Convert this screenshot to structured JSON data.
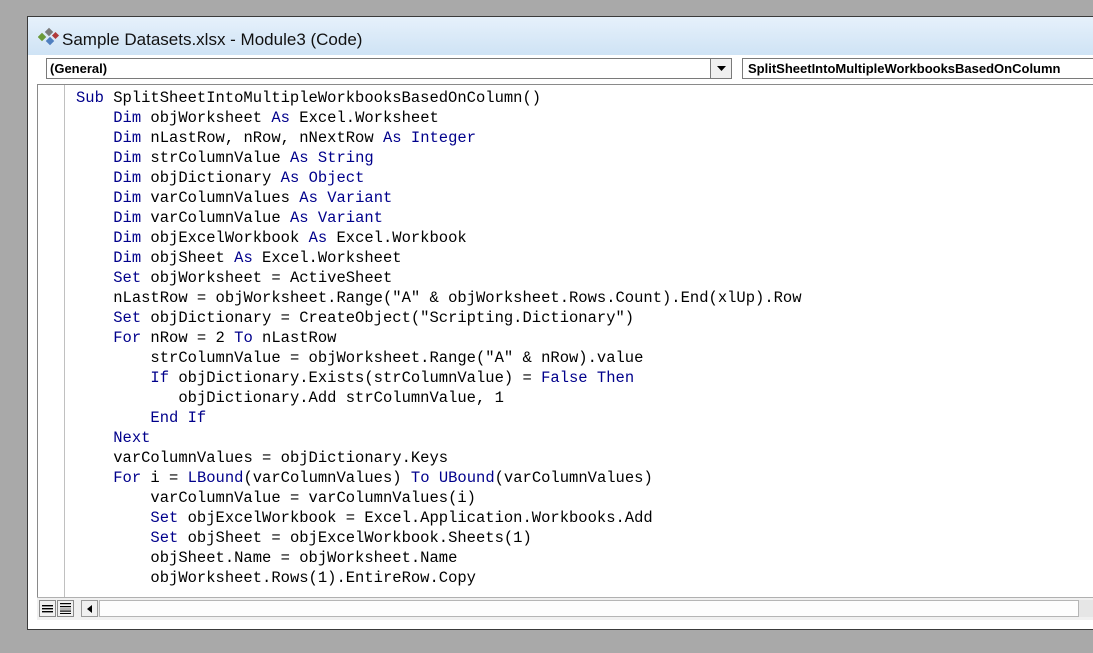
{
  "window": {
    "title": "Sample Datasets.xlsx - Module3 (Code)",
    "title_icon": "vba-code-module-icon"
  },
  "object_combo": {
    "value": "(General)",
    "dropdown_icon": "chevron-down-icon"
  },
  "procedure_combo": {
    "value": "SplitSheetIntoMultipleWorkbooksBasedOnColumn"
  },
  "colors": {
    "keyword": "#00008b",
    "text": "#000000",
    "background": "#a9a9a9"
  },
  "code_lines": [
    {
      "indent": 0,
      "segments": [
        {
          "text": "Sub",
          "kw": true
        },
        {
          "text": " SplitSheetIntoMultipleWorkbooksBasedOnColumn()"
        }
      ]
    },
    {
      "indent": 4,
      "segments": [
        {
          "text": "Dim",
          "kw": true
        },
        {
          "text": " objWorksheet "
        },
        {
          "text": "As",
          "kw": true
        },
        {
          "text": " Excel.Worksheet"
        }
      ]
    },
    {
      "indent": 4,
      "segments": [
        {
          "text": "Dim",
          "kw": true
        },
        {
          "text": " nLastRow, nRow, nNextRow "
        },
        {
          "text": "As",
          "kw": true
        },
        {
          "text": " "
        },
        {
          "text": "Integer",
          "kw": true
        }
      ]
    },
    {
      "indent": 4,
      "segments": [
        {
          "text": "Dim",
          "kw": true
        },
        {
          "text": " strColumnValue "
        },
        {
          "text": "As",
          "kw": true
        },
        {
          "text": " "
        },
        {
          "text": "String",
          "kw": true
        }
      ]
    },
    {
      "indent": 4,
      "segments": [
        {
          "text": "Dim",
          "kw": true
        },
        {
          "text": " objDictionary "
        },
        {
          "text": "As",
          "kw": true
        },
        {
          "text": " "
        },
        {
          "text": "Object",
          "kw": true
        }
      ]
    },
    {
      "indent": 4,
      "segments": [
        {
          "text": "Dim",
          "kw": true
        },
        {
          "text": " varColumnValues "
        },
        {
          "text": "As",
          "kw": true
        },
        {
          "text": " "
        },
        {
          "text": "Variant",
          "kw": true
        }
      ]
    },
    {
      "indent": 4,
      "segments": [
        {
          "text": "Dim",
          "kw": true
        },
        {
          "text": " varColumnValue "
        },
        {
          "text": "As",
          "kw": true
        },
        {
          "text": " "
        },
        {
          "text": "Variant",
          "kw": true
        }
      ]
    },
    {
      "indent": 4,
      "segments": [
        {
          "text": "Dim",
          "kw": true
        },
        {
          "text": " objExcelWorkbook "
        },
        {
          "text": "As",
          "kw": true
        },
        {
          "text": " Excel.Workbook"
        }
      ]
    },
    {
      "indent": 4,
      "segments": [
        {
          "text": "Dim",
          "kw": true
        },
        {
          "text": " objSheet "
        },
        {
          "text": "As",
          "kw": true
        },
        {
          "text": " Excel.Worksheet"
        }
      ]
    },
    {
      "indent": 4,
      "segments": [
        {
          "text": "Set",
          "kw": true
        },
        {
          "text": " objWorksheet = ActiveSheet"
        }
      ]
    },
    {
      "indent": 4,
      "segments": [
        {
          "text": "nLastRow = objWorksheet.Range(\"A\" & objWorksheet.Rows.Count).End(xlUp).Row"
        }
      ]
    },
    {
      "indent": 4,
      "segments": [
        {
          "text": "Set",
          "kw": true
        },
        {
          "text": " objDictionary = CreateObject(\"Scripting.Dictionary\")"
        }
      ]
    },
    {
      "indent": 4,
      "segments": [
        {
          "text": "For",
          "kw": true
        },
        {
          "text": " nRow = 2 "
        },
        {
          "text": "To",
          "kw": true
        },
        {
          "text": " nLastRow"
        }
      ]
    },
    {
      "indent": 8,
      "segments": [
        {
          "text": "strColumnValue = objWorksheet.Range(\"A\" & nRow).value"
        }
      ]
    },
    {
      "indent": 8,
      "segments": [
        {
          "text": "If",
          "kw": true
        },
        {
          "text": " objDictionary.Exists(strColumnValue) = "
        },
        {
          "text": "False",
          "kw": true
        },
        {
          "text": " "
        },
        {
          "text": "Then",
          "kw": true
        }
      ]
    },
    {
      "indent": 11,
      "segments": [
        {
          "text": "objDictionary.Add strColumnValue, 1"
        }
      ]
    },
    {
      "indent": 8,
      "segments": [
        {
          "text": "End If",
          "kw": true
        }
      ]
    },
    {
      "indent": 4,
      "segments": [
        {
          "text": "Next",
          "kw": true
        }
      ]
    },
    {
      "indent": 4,
      "segments": [
        {
          "text": "varColumnValues = objDictionary.Keys"
        }
      ]
    },
    {
      "indent": 4,
      "segments": [
        {
          "text": "For",
          "kw": true
        },
        {
          "text": " i = "
        },
        {
          "text": "LBound",
          "kw": true
        },
        {
          "text": "(varColumnValues) "
        },
        {
          "text": "To",
          "kw": true
        },
        {
          "text": " "
        },
        {
          "text": "UBound",
          "kw": true
        },
        {
          "text": "(varColumnValues)"
        }
      ]
    },
    {
      "indent": 8,
      "segments": [
        {
          "text": "varColumnValue = varColumnValues(i)"
        }
      ]
    },
    {
      "indent": 8,
      "segments": [
        {
          "text": "Set",
          "kw": true
        },
        {
          "text": " objExcelWorkbook = Excel.Application.Workbooks.Add"
        }
      ]
    },
    {
      "indent": 8,
      "segments": [
        {
          "text": "Set",
          "kw": true
        },
        {
          "text": " objSheet = objExcelWorkbook.Sheets(1)"
        }
      ]
    },
    {
      "indent": 8,
      "segments": [
        {
          "text": "objSheet.Name = objWorksheet.Name"
        }
      ]
    },
    {
      "indent": 8,
      "segments": [
        {
          "text": "objWorksheet.Rows(1).EntireRow.Copy"
        }
      ]
    }
  ],
  "footer": {
    "procedure_view_icon": "procedure-view-icon",
    "full_module_view_icon": "full-module-view-icon",
    "scroll_left_icon": "scroll-left-arrow-icon"
  }
}
